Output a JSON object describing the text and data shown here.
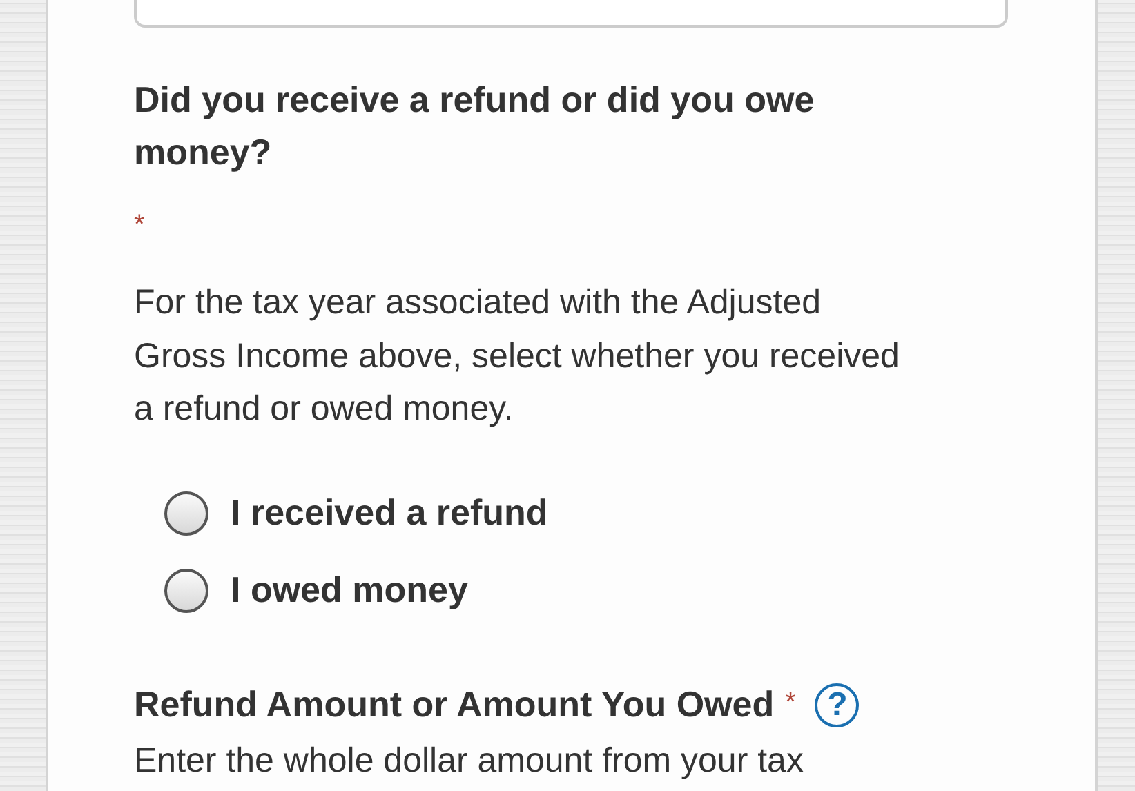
{
  "question": {
    "title": "Did you receive a refund or did you owe money?",
    "required_mark": "*",
    "description": "For the tax year associated with the Adjusted Gross Income above, select whether you received a refund or owed money.",
    "options": [
      {
        "label": "I received a refund",
        "selected": false
      },
      {
        "label": "I owed money",
        "selected": false
      }
    ]
  },
  "next_question": {
    "title": "Refund Amount or Amount You Owed",
    "required_mark": "*",
    "help": "?",
    "description": "Enter the whole dollar amount from your tax"
  }
}
